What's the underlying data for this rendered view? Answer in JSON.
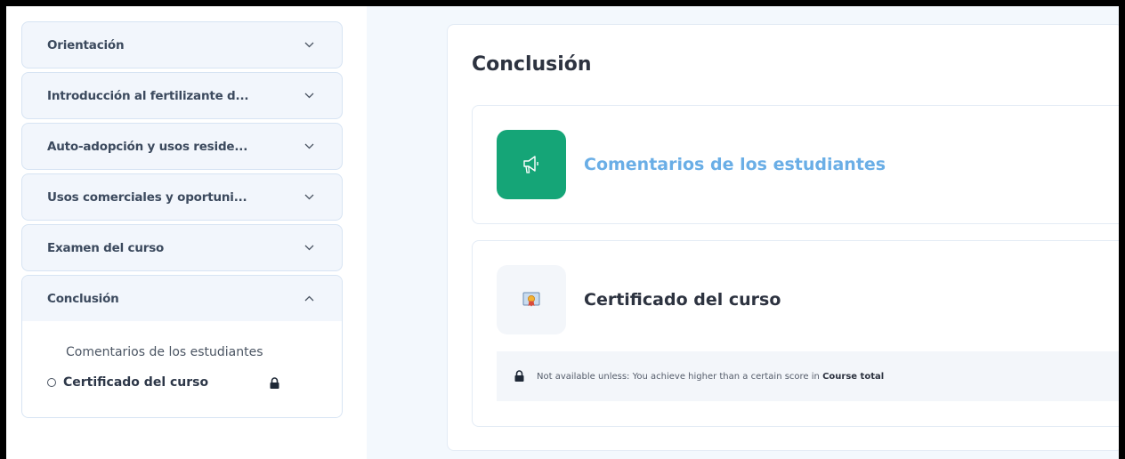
{
  "sidebar": {
    "sections": [
      {
        "title": "Orientación",
        "chevron": "chevron-down-icon"
      },
      {
        "title": "Introducción al fertilizante d...",
        "chevron": "chevron-down-icon"
      },
      {
        "title": "Auto-adopción y usos reside...",
        "chevron": "chevron-down-icon"
      },
      {
        "title": "Usos comerciales y oportuni...",
        "chevron": "chevron-down-icon"
      },
      {
        "title": "Examen del curso",
        "chevron": "chevron-down-icon"
      },
      {
        "title": "Conclusión",
        "chevron": "chevron-up-icon",
        "expanded": true
      }
    ],
    "conclusion_activities": [
      {
        "label": "Comentarios de los estudiantes"
      },
      {
        "label": "Certificado del curso",
        "current": true,
        "locked": true
      }
    ]
  },
  "main": {
    "title": "Conclusión",
    "activities": [
      {
        "name": "Comentarios de los estudiantes",
        "icon": "megaphone-icon",
        "icon_bg": "#15a577",
        "color": "#6aaee6"
      },
      {
        "name": "Certificado del curso",
        "icon": "certificate-icon",
        "color": "#2d3340"
      }
    ],
    "restriction": {
      "prefix": "Not available unless: You achieve higher than a certain score in ",
      "bold": "Course total"
    }
  }
}
